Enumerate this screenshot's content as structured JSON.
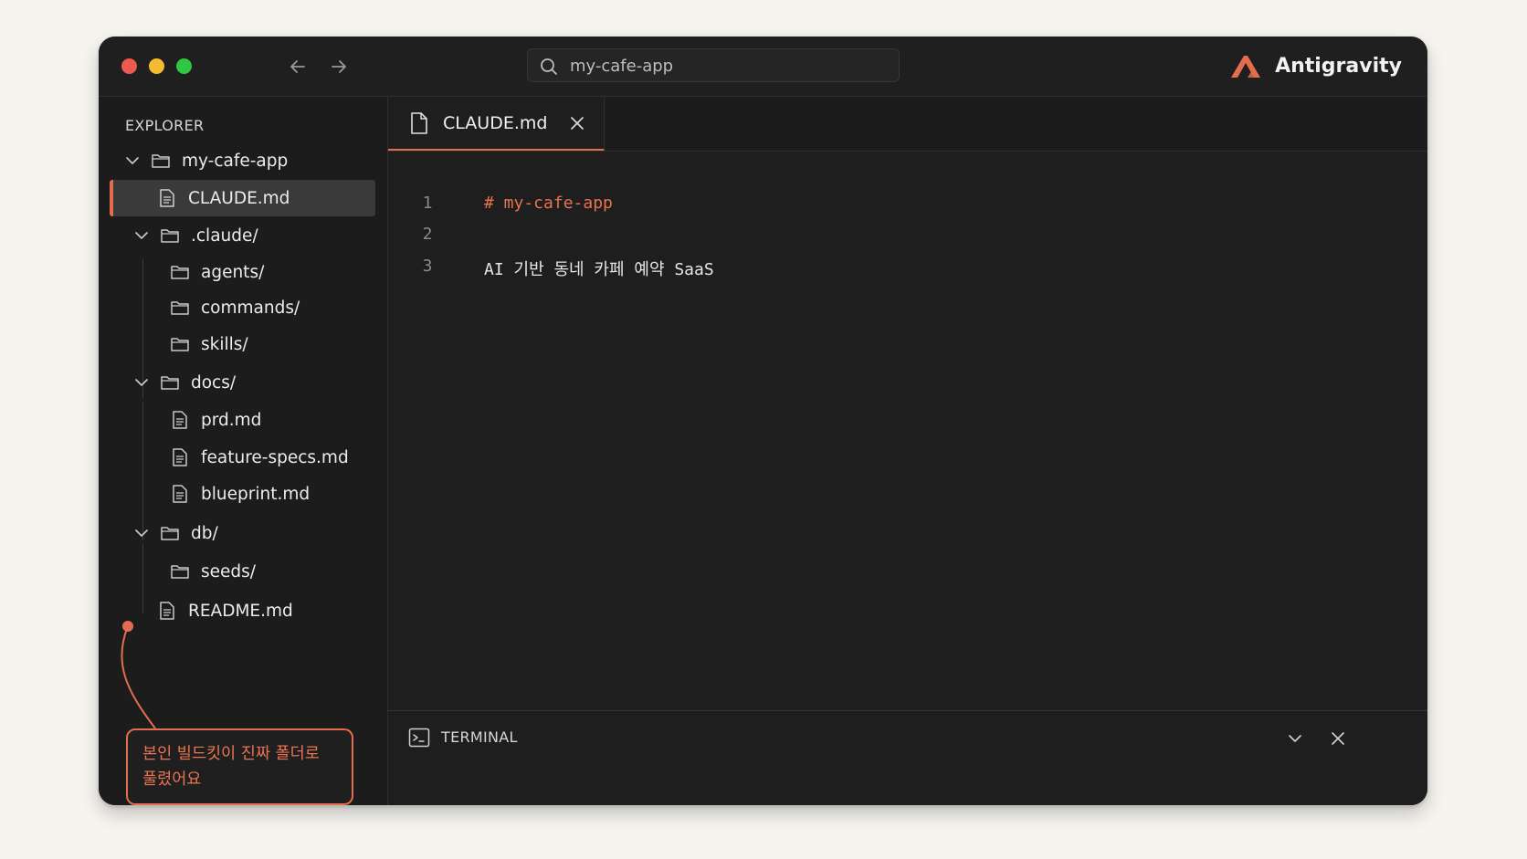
{
  "window": {
    "search_text": "my-cafe-app",
    "brand_name": "Antigravity",
    "accent_color": "#e36d4e"
  },
  "sidebar": {
    "title": "EXPLORER",
    "tree": [
      {
        "label": "my-cafe-app",
        "kind": "folder",
        "expanded": true
      },
      {
        "label": "CLAUDE.md",
        "kind": "file",
        "selected": true
      },
      {
        "label": ".claude/",
        "kind": "folder",
        "expanded": true
      },
      {
        "label": "agents/",
        "kind": "folder"
      },
      {
        "label": "commands/",
        "kind": "folder"
      },
      {
        "label": "skills/",
        "kind": "folder"
      },
      {
        "label": "docs/",
        "kind": "folder",
        "expanded": true
      },
      {
        "label": "prd.md",
        "kind": "file"
      },
      {
        "label": "feature-specs.md",
        "kind": "file"
      },
      {
        "label": "blueprint.md",
        "kind": "file"
      },
      {
        "label": "db/",
        "kind": "folder",
        "expanded": true
      },
      {
        "label": "seeds/",
        "kind": "folder"
      },
      {
        "label": "README.md",
        "kind": "file"
      }
    ],
    "callout": {
      "line1": "본인 빌드킷이 진짜 폴더로",
      "line2": "풀렸어요"
    }
  },
  "editor": {
    "tab_label": "CLAUDE.md",
    "lines": [
      {
        "number": "1",
        "text": "# my-cafe-app"
      },
      {
        "number": "2",
        "text": ""
      },
      {
        "number": "3",
        "text": "AI 기반 동네 카페 예약 SaaS"
      }
    ]
  },
  "terminal": {
    "label": "TERMINAL"
  }
}
